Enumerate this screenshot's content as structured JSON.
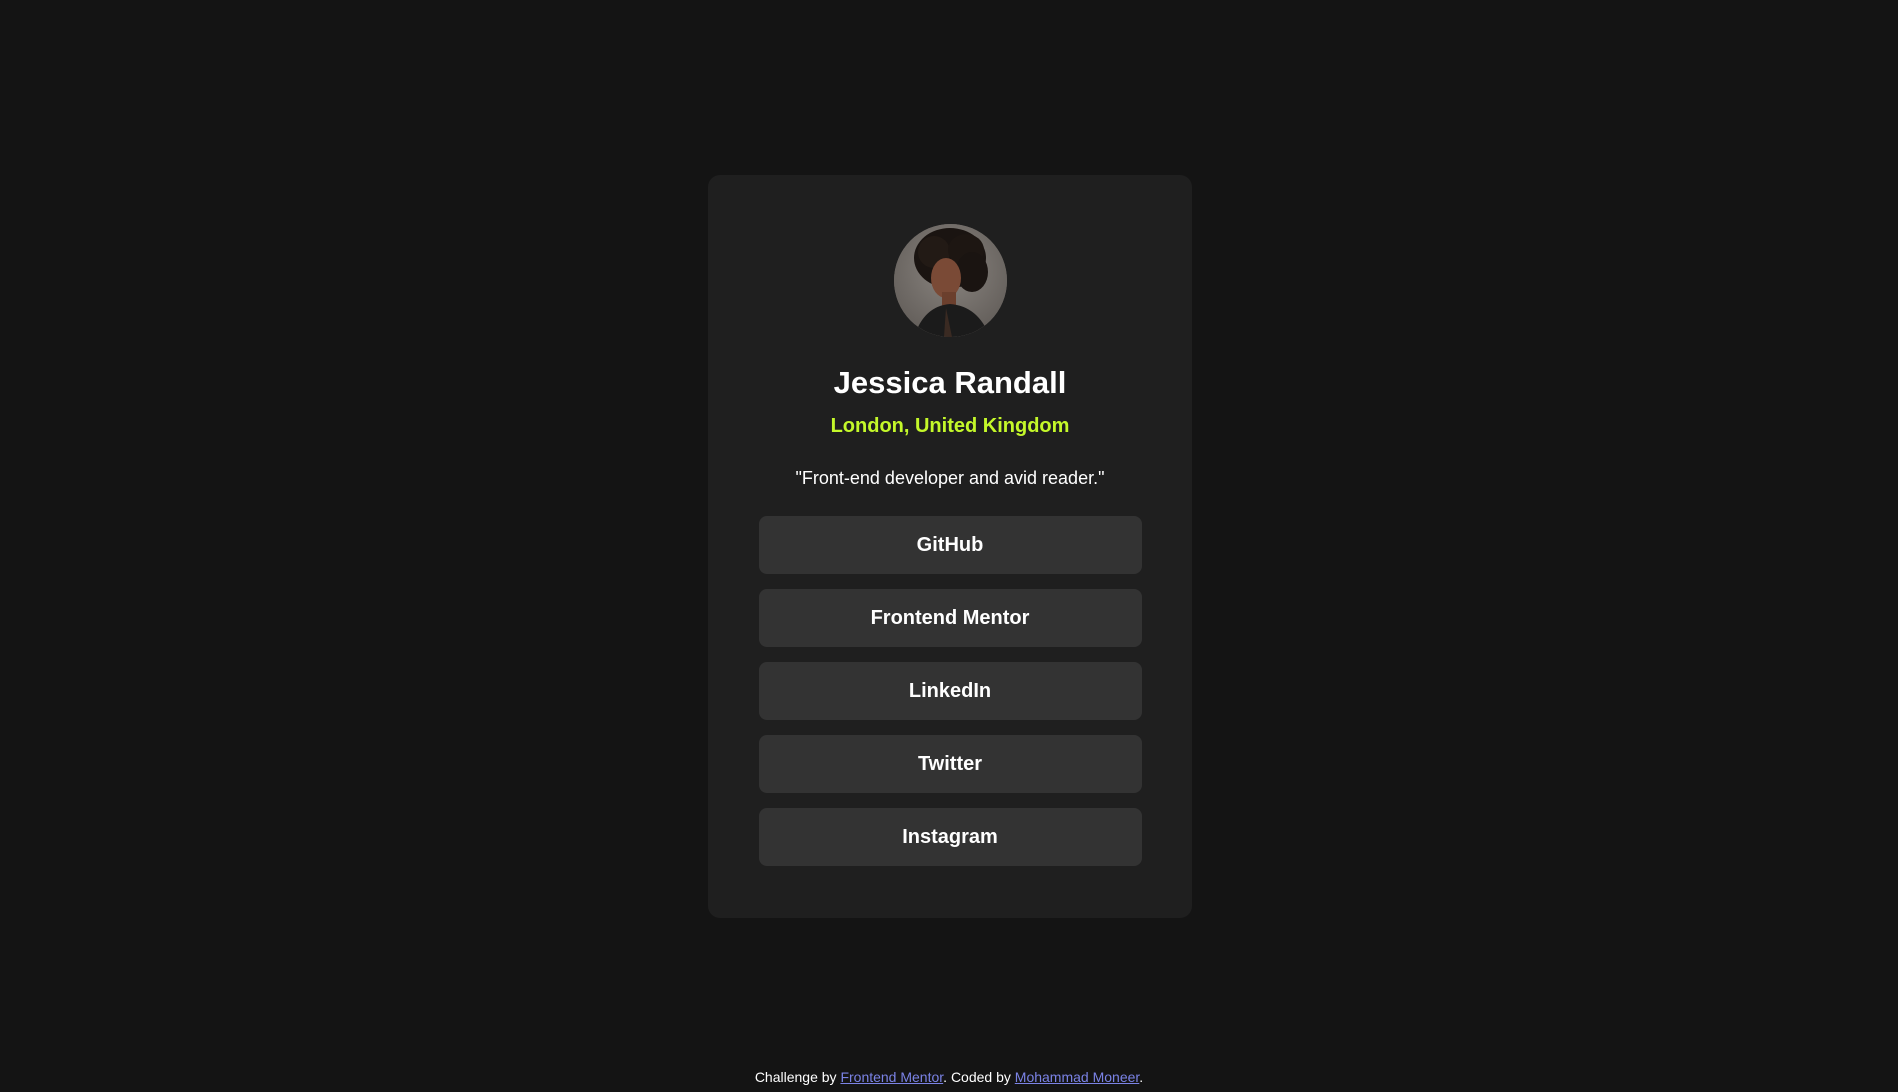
{
  "profile": {
    "name": "Jessica Randall",
    "location": "London, United Kingdom",
    "bio": "\"Front-end developer and avid reader.\"",
    "avatar_alt": "Jessica Randall avatar"
  },
  "links": [
    {
      "label": "GitHub"
    },
    {
      "label": "Frontend Mentor"
    },
    {
      "label": "LinkedIn"
    },
    {
      "label": "Twitter"
    },
    {
      "label": "Instagram"
    }
  ],
  "attribution": {
    "prefix": "Challenge by ",
    "challenge_link": "Frontend Mentor",
    "middle": ". Coded by ",
    "author_link": "Mohammad Moneer",
    "suffix": "."
  },
  "colors": {
    "background": "#141414",
    "card": "#1f1f1f",
    "button": "#333333",
    "accent": "#c4f82a",
    "link": "#7b83e6"
  }
}
